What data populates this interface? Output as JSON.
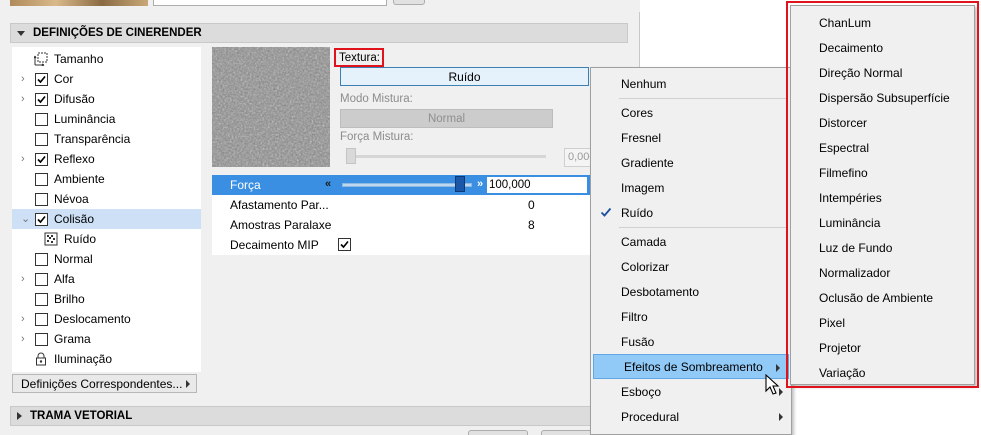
{
  "section_cinerender": {
    "title": "DEFINIÇÕES DE CINERENDER"
  },
  "section_vector": {
    "title": "TRAMA VETORIAL"
  },
  "tree": [
    {
      "label": "Tamanho",
      "expander": "",
      "kind": "icon",
      "icon": "resize-icon"
    },
    {
      "label": "Cor",
      "expander": "›",
      "kind": "check",
      "checked": true
    },
    {
      "label": "Difusão",
      "expander": "›",
      "kind": "check",
      "checked": true
    },
    {
      "label": "Luminância",
      "expander": "",
      "kind": "check",
      "checked": false
    },
    {
      "label": "Transparência",
      "expander": "",
      "kind": "check",
      "checked": false
    },
    {
      "label": "Reflexo",
      "expander": "›",
      "kind": "check",
      "checked": true
    },
    {
      "label": "Ambiente",
      "expander": "",
      "kind": "check",
      "checked": false
    },
    {
      "label": "Névoa",
      "expander": "",
      "kind": "check",
      "checked": false
    },
    {
      "label": "Colisão",
      "expander": "⌄",
      "kind": "check",
      "checked": true,
      "selected": true
    },
    {
      "label": "Ruído",
      "expander": "",
      "kind": "icon",
      "icon": "noise-texture-icon",
      "sub": true
    },
    {
      "label": "Normal",
      "expander": "",
      "kind": "check",
      "checked": false
    },
    {
      "label": "Alfa",
      "expander": "›",
      "kind": "check",
      "checked": false
    },
    {
      "label": "Brilho",
      "expander": "",
      "kind": "check",
      "checked": false
    },
    {
      "label": "Deslocamento",
      "expander": "›",
      "kind": "check",
      "checked": false
    },
    {
      "label": "Grama",
      "expander": "›",
      "kind": "check",
      "checked": false
    },
    {
      "label": "Iluminação",
      "expander": "",
      "kind": "icon",
      "icon": "lock-icon"
    }
  ],
  "matching_dropdown": {
    "label": "Definições Correspondentes..."
  },
  "texture": {
    "label": "Textura:",
    "button_label": "Ruído",
    "mix_mode_label": "Modo Mistura:",
    "mix_mode_value": "Normal",
    "mix_strength_label": "Força Mistura:",
    "mix_strength_value": "0,000"
  },
  "params": [
    {
      "name": "Força",
      "value": "100,000",
      "highlighted": true,
      "slider_fraction": 0.9
    },
    {
      "name": "Afastamento Par...",
      "value": "0"
    },
    {
      "name": "Amostras Paralaxe",
      "value": "8"
    },
    {
      "name": "Decaimento MIP",
      "checkbox": true,
      "checked": true
    }
  ],
  "menu": {
    "groups": [
      [
        {
          "label": "Nenhum"
        }
      ],
      [
        {
          "label": "Cores"
        },
        {
          "label": "Fresnel"
        },
        {
          "label": "Gradiente"
        },
        {
          "label": "Imagem"
        },
        {
          "label": "Ruído",
          "checked": true
        }
      ],
      [
        {
          "label": "Camada"
        },
        {
          "label": "Colorizar"
        },
        {
          "label": "Desbotamento"
        },
        {
          "label": "Filtro"
        },
        {
          "label": "Fusão"
        },
        {
          "label": "Efeitos de Sombreamento",
          "submenu": true,
          "active": true
        },
        {
          "label": "Esboço",
          "submenu": true
        },
        {
          "label": "Procedural",
          "submenu": true
        }
      ]
    ]
  },
  "submenu": {
    "items": [
      "ChanLum",
      "Decaimento",
      "Direção Normal",
      "Dispersão Subsuperfície",
      "Distorcer",
      "Espectral",
      "Filmefino",
      "Intempéries",
      "Luminância",
      "Luz de Fundo",
      "Normalizador",
      "Oclusão de Ambiente",
      "Pixel",
      "Projetor",
      "Variação"
    ]
  },
  "colors": {
    "highlight": "#3b8fe3",
    "menu_active": "#91c9f7",
    "annotation_red": "#e0121b"
  }
}
